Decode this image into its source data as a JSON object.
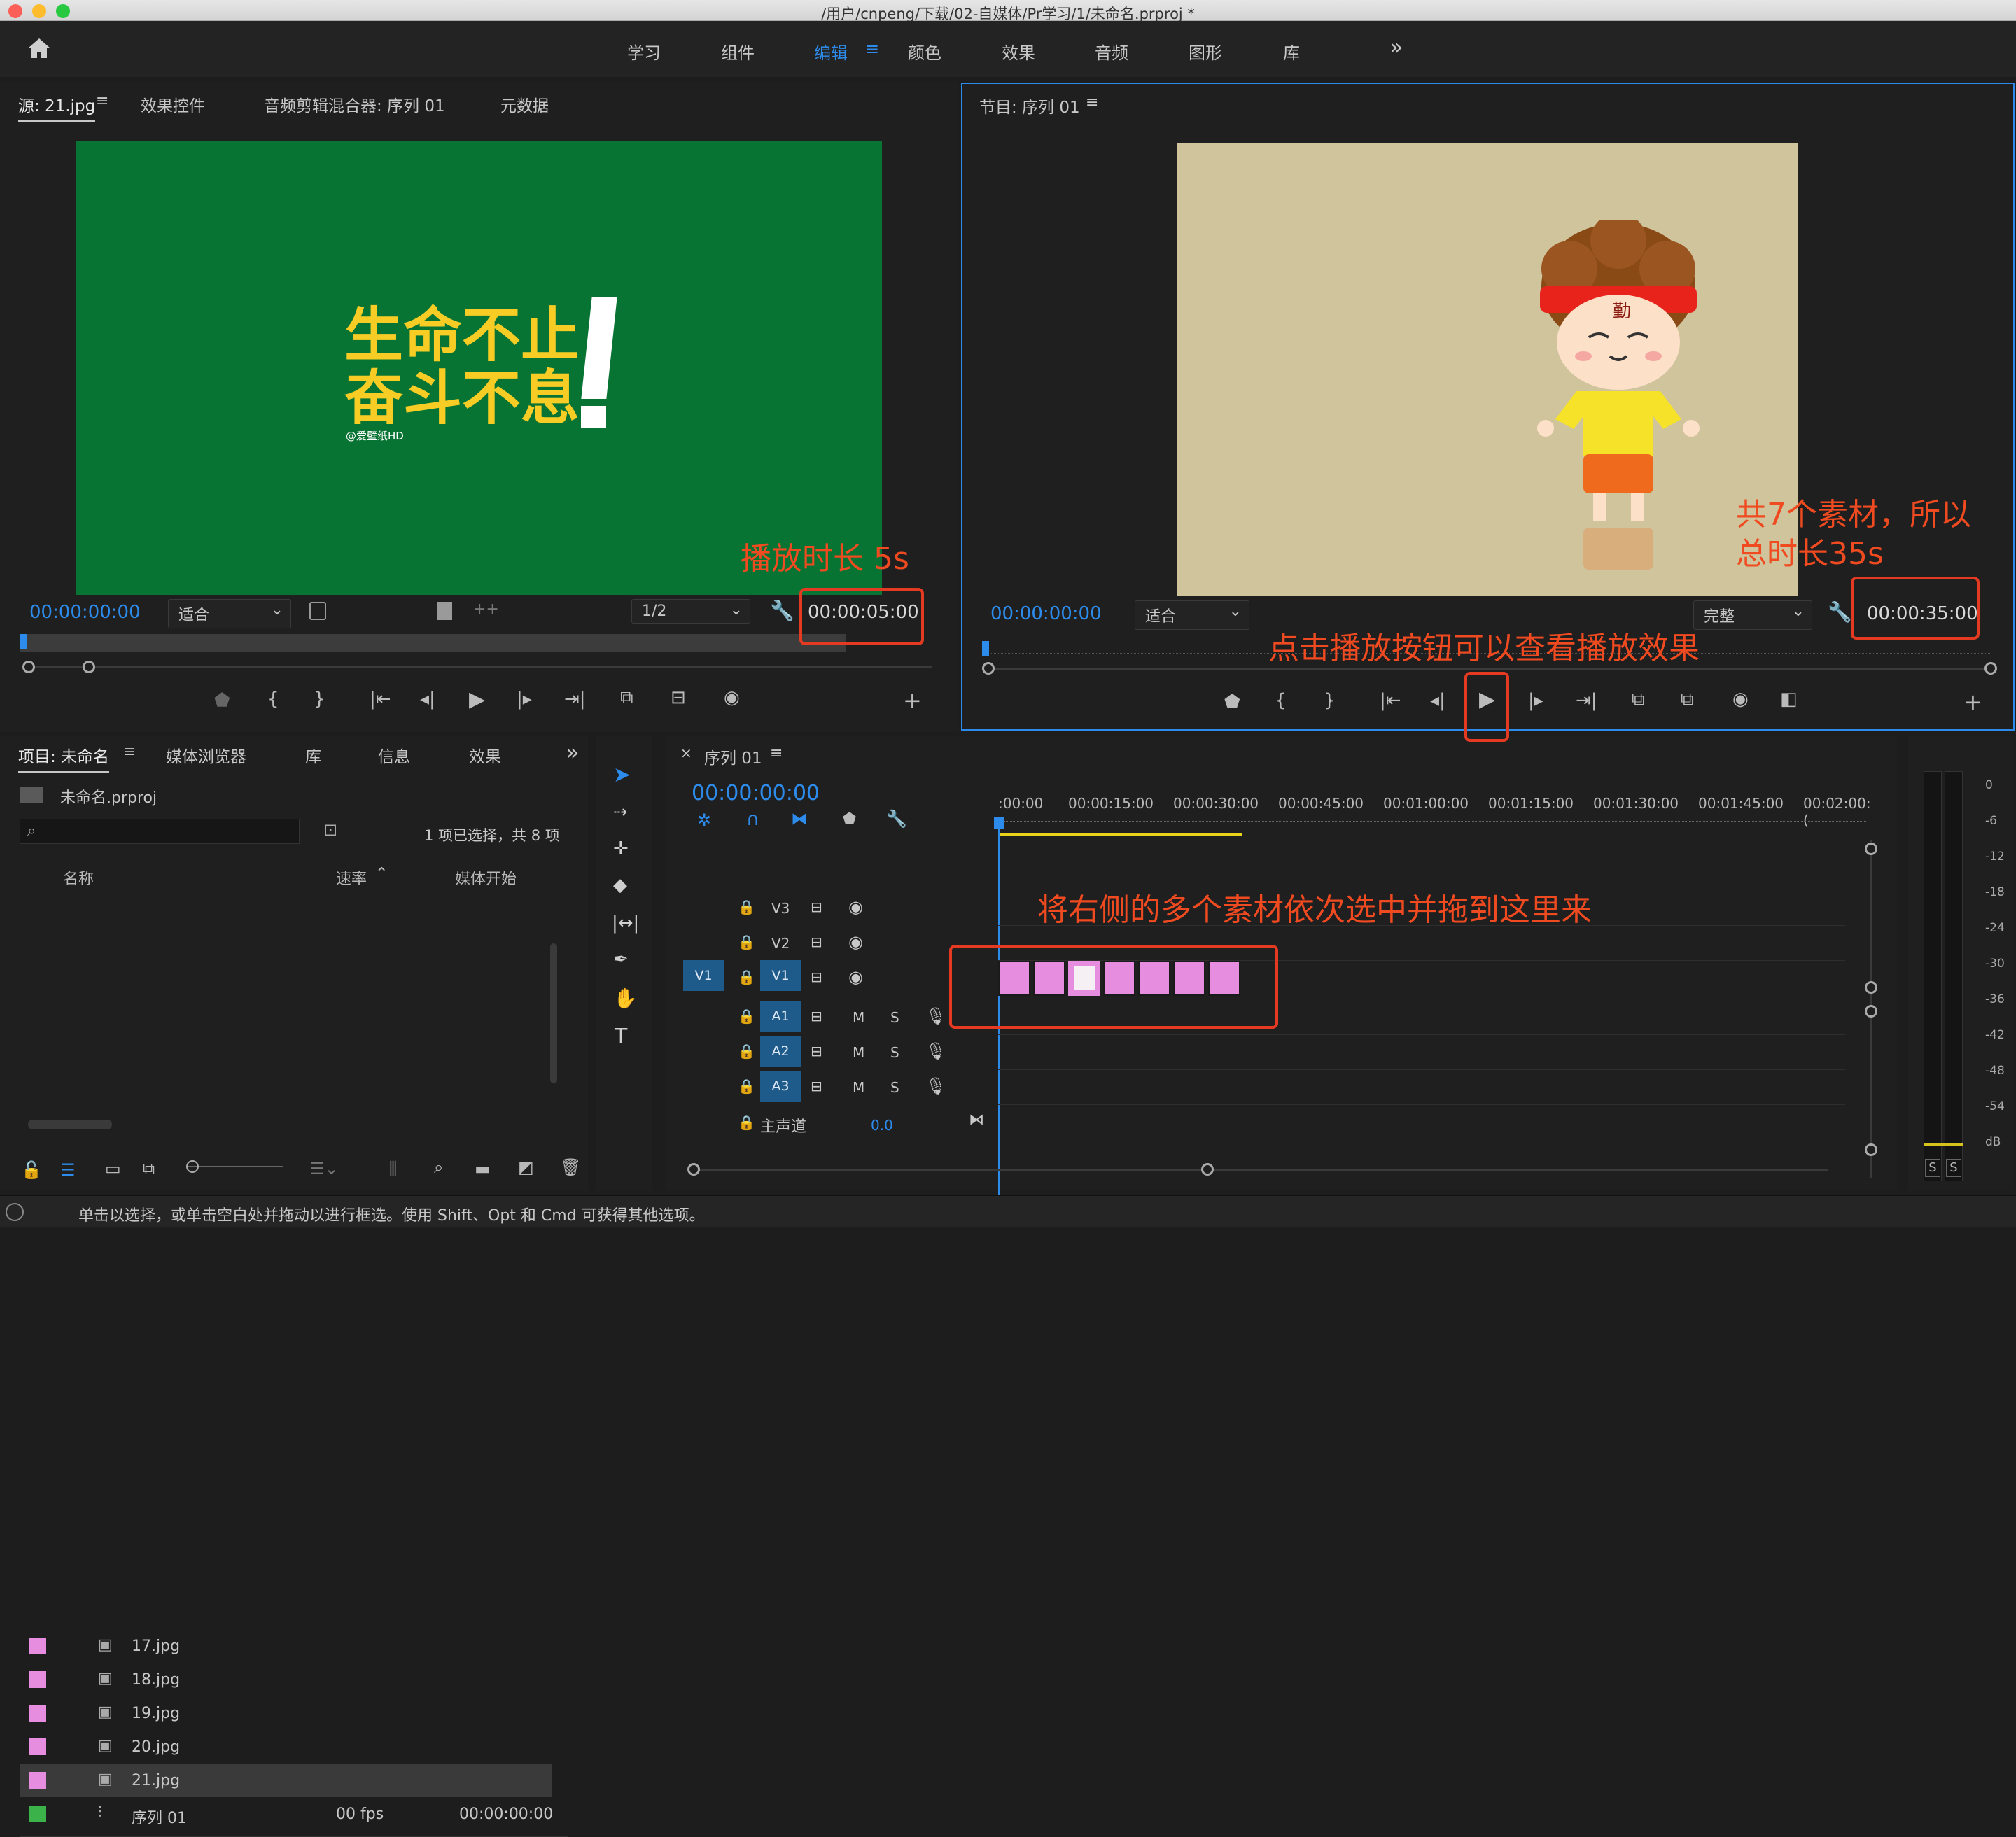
{
  "window": {
    "title": "/用户/cnpeng/下载/02-自媒体/Pr学习/1/未命名.prproj *"
  },
  "workspace": {
    "tabs": [
      "学习",
      "组件",
      "编辑",
      "颜色",
      "效果",
      "音频",
      "图形",
      "库"
    ],
    "active": "编辑",
    "menu_glyph": "≡",
    "more": "»"
  },
  "source": {
    "tabs": [
      "源: 21.jpg",
      "效果控件",
      "音频剪辑混合器: 序列 01",
      "元数据"
    ],
    "image_line1": "生命不止",
    "image_line2": "奋斗不息",
    "image_credit": "@爱壁纸HD",
    "timecode": "00:00:00:00",
    "fit": "适合",
    "resolution": "1/2",
    "duration": "00:00:05:00"
  },
  "program": {
    "title": "节目: 序列 01",
    "headband_char": "勤",
    "timecode": "00:00:00:00",
    "fit": "适合",
    "quality": "完整",
    "duration": "00:00:35:00"
  },
  "project": {
    "tabs": [
      "项目: 未命名",
      "媒体浏览器",
      "库",
      "信息",
      "效果"
    ],
    "filename": "未命名.prproj",
    "selection_info": "1 项已选择，共 8 项",
    "columns": [
      "名称",
      "速率",
      "媒体开始"
    ],
    "items": [
      {
        "name": "17.jpg",
        "rate": "",
        "start": "",
        "color": "#e68de0"
      },
      {
        "name": "18.jpg",
        "rate": "",
        "start": "",
        "color": "#e68de0"
      },
      {
        "name": "19.jpg",
        "rate": "",
        "start": "",
        "color": "#e68de0"
      },
      {
        "name": "20.jpg",
        "rate": "",
        "start": "",
        "color": "#e68de0"
      },
      {
        "name": "21.jpg",
        "rate": "",
        "start": "",
        "color": "#e68de0"
      },
      {
        "name": "序列 01",
        "rate": "00 fps",
        "start": "00:00:00:00",
        "color": "#3cb34a"
      }
    ]
  },
  "timeline": {
    "sequence": "序列 01",
    "timecode": "00:00:00:00",
    "ruler": [
      ":00:00",
      "00:00:15:00",
      "00:00:30:00",
      "00:00:45:00",
      "00:01:00:00",
      "00:01:15:00",
      "00:01:30:00",
      "00:01:45:00",
      "00:02:00:("
    ],
    "video_tracks": [
      "V3",
      "V2",
      "V1"
    ],
    "audio_tracks": [
      "A1",
      "A2",
      "A3"
    ],
    "source_patch_v": "V1",
    "mute": "M",
    "solo": "S",
    "master_label": "主声道",
    "master_value": "0.0",
    "clip_count": 7
  },
  "meter": {
    "scale": [
      "0",
      "-6",
      "-12",
      "-18",
      "-24",
      "-30",
      "-36",
      "-42",
      "-48",
      "-54",
      "dB"
    ],
    "solo": [
      "S",
      "S"
    ]
  },
  "annotations": {
    "source_duration": "播放时长 5s",
    "program_total_line1": "共7个素材，所以",
    "program_total_line2": "总时长35s",
    "play_hint": "点击播放按钮可以查看播放效果",
    "drag_hint": "将右侧的多个素材依次选中并拖到这里来"
  },
  "status": {
    "text": "单击以选择，或单击空白处并拖动以进行框选。使用 Shift、Opt 和 Cmd 可获得其他选项。"
  },
  "colors": {
    "accent": "#2d8ceb",
    "annotation": "#e53a22",
    "source_bg": "#087433",
    "program_bg": "#cfc49c",
    "clip": "#e68de0"
  }
}
